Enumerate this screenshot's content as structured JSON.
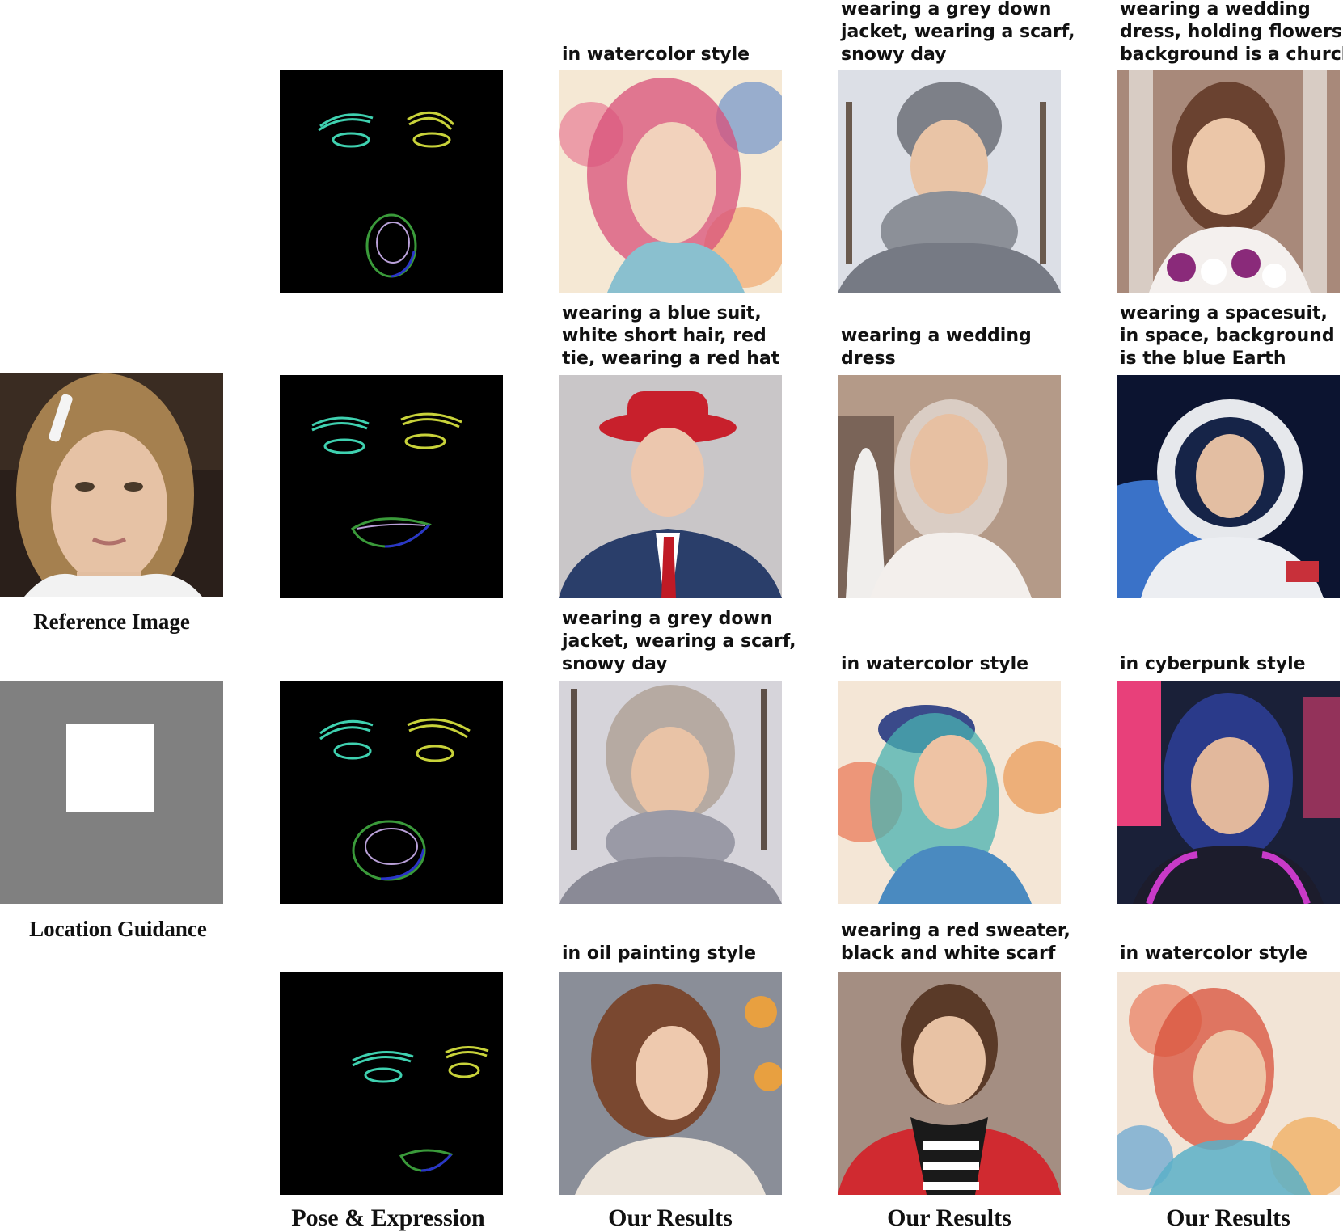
{
  "figure": {
    "left_labels": {
      "reference": "Reference Image",
      "location": "Location Guidance"
    },
    "column_labels": {
      "pose": "Pose & Expression",
      "results_1": "Our Results",
      "results_2": "Our Results",
      "results_3": "Our Results"
    },
    "rows": [
      {
        "prompts": [
          "in watercolor style",
          "wearing a grey down\njacket, wearing a scarf,\nsnowy day",
          "wearing a wedding\ndress, holding flowers,\nbackground is a church"
        ]
      },
      {
        "prompts": [
          "wearing a blue suit,\nwhite short hair, red\ntie, wearing a red hat",
          "wearing a wedding\ndress",
          "wearing a spacesuit,\nin space, background\nis the blue Earth"
        ]
      },
      {
        "prompts": [
          "wearing a grey down\njacket, wearing a scarf,\nsnowy day",
          "in watercolor style",
          "in cyberpunk style"
        ]
      },
      {
        "prompts": [
          "in oil painting style",
          "wearing a red sweater,\nblack and white scarf",
          "in watercolor style"
        ]
      }
    ]
  },
  "colors": {
    "left_eye": "#3fd1b0",
    "right_eye": "#c8d23a",
    "mouth_outer": "#3a9a3a",
    "mouth_blue": "#2a35c8",
    "location_bg": "#808080",
    "location_box": "#ffffff"
  }
}
